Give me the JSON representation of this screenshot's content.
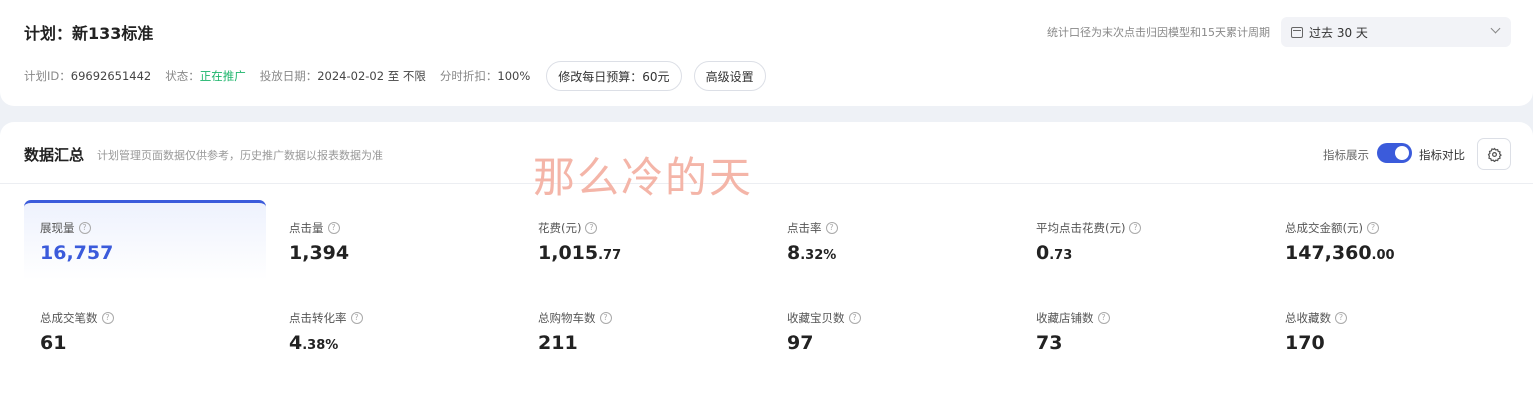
{
  "plan": {
    "title": "计划：新133标准",
    "id_label": "计划ID：",
    "id_value": "69692651442",
    "status_label": "状态：",
    "status_value": "正在推广",
    "date_label": "投放日期：",
    "date_value": "2024-02-02 至 不限",
    "discount_label": "分时折扣：",
    "discount_value": "100%",
    "budget_button": "修改每日预算：60元",
    "advanced_button": "高级设置",
    "stats_note": "统计口径为末次点击归因模型和15天累计周期",
    "date_range": "过去 30 天",
    "status_color": "#1db56b"
  },
  "summary": {
    "title": "数据汇总",
    "desc": "计划管理页面数据仅供参考，历史推广数据以报表数据为准",
    "watermark": "那么冷的天",
    "metric_show_label": "指标展示",
    "metric_compare_label": "指标对比",
    "toggle_on": true,
    "accent_color": "#3b5bdb"
  },
  "metrics": [
    {
      "label": "展现量",
      "int": "16,757",
      "dec": "",
      "active": true
    },
    {
      "label": "点击量",
      "int": "1,394",
      "dec": ""
    },
    {
      "label": "花费(元)",
      "int": "1,015",
      "dec": ".77"
    },
    {
      "label": "点击率",
      "int": "8",
      "dec": ".32%"
    },
    {
      "label": "平均点击花费(元)",
      "int": "0",
      "dec": ".73"
    },
    {
      "label": "总成交金额(元)",
      "int": "147,360",
      "dec": ".00"
    },
    {
      "label": "总成交笔数",
      "int": "61",
      "dec": ""
    },
    {
      "label": "点击转化率",
      "int": "4",
      "dec": ".38%"
    },
    {
      "label": "总购物车数",
      "int": "211",
      "dec": ""
    },
    {
      "label": "收藏宝贝数",
      "int": "97",
      "dec": ""
    },
    {
      "label": "收藏店铺数",
      "int": "73",
      "dec": ""
    },
    {
      "label": "总收藏数",
      "int": "170",
      "dec": ""
    }
  ]
}
